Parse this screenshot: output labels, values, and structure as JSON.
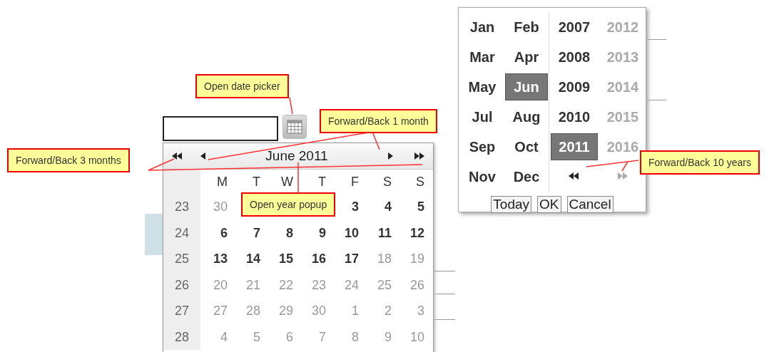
{
  "calendar": {
    "title": "June 2011",
    "weekdays": [
      "M",
      "T",
      "W",
      "T",
      "F",
      "S",
      "S"
    ],
    "weeks": [
      {
        "number": "23",
        "days": [
          {
            "label": "30",
            "enabled": false
          },
          {
            "label": "3",
            "enabled": true
          },
          {
            "label": "4",
            "enabled": true
          },
          {
            "label": "5",
            "enabled": true
          }
        ]
      },
      {
        "number": "24",
        "days": [
          {
            "label": "6",
            "enabled": true
          },
          {
            "label": "7",
            "enabled": true
          },
          {
            "label": "8",
            "enabled": true
          },
          {
            "label": "9",
            "enabled": true
          },
          {
            "label": "10",
            "enabled": true
          },
          {
            "label": "11",
            "enabled": true
          },
          {
            "label": "12",
            "enabled": true
          }
        ]
      },
      {
        "number": "25",
        "days": [
          {
            "label": "13",
            "enabled": true
          },
          {
            "label": "14",
            "enabled": true
          },
          {
            "label": "15",
            "enabled": true
          },
          {
            "label": "16",
            "enabled": true
          },
          {
            "label": "17",
            "enabled": true
          },
          {
            "label": "18",
            "enabled": false
          },
          {
            "label": "19",
            "enabled": false
          }
        ]
      },
      {
        "number": "26",
        "days": [
          {
            "label": "20",
            "enabled": false
          },
          {
            "label": "21",
            "enabled": false
          },
          {
            "label": "22",
            "enabled": false
          },
          {
            "label": "23",
            "enabled": false
          },
          {
            "label": "24",
            "enabled": false
          },
          {
            "label": "25",
            "enabled": false
          },
          {
            "label": "26",
            "enabled": false
          }
        ]
      },
      {
        "number": "27",
        "days": [
          {
            "label": "27",
            "enabled": false
          },
          {
            "label": "28",
            "enabled": false
          },
          {
            "label": "29",
            "enabled": false
          },
          {
            "label": "30",
            "enabled": false
          },
          {
            "label": "1",
            "enabled": false
          },
          {
            "label": "2",
            "enabled": false
          },
          {
            "label": "3",
            "enabled": false
          }
        ]
      },
      {
        "number": "28",
        "days": [
          {
            "label": "4",
            "enabled": false
          },
          {
            "label": "5",
            "enabled": false
          },
          {
            "label": "6",
            "enabled": false
          },
          {
            "label": "7",
            "enabled": false
          },
          {
            "label": "8",
            "enabled": false
          },
          {
            "label": "9",
            "enabled": false
          },
          {
            "label": "10",
            "enabled": false
          }
        ]
      }
    ]
  },
  "year_popup": {
    "months": [
      {
        "label": "Jan",
        "selected": false
      },
      {
        "label": "Feb",
        "selected": false
      },
      {
        "label": "Mar",
        "selected": false
      },
      {
        "label": "Apr",
        "selected": false
      },
      {
        "label": "May",
        "selected": false
      },
      {
        "label": "Jun",
        "selected": true
      },
      {
        "label": "Jul",
        "selected": false
      },
      {
        "label": "Aug",
        "selected": false
      },
      {
        "label": "Sep",
        "selected": false
      },
      {
        "label": "Oct",
        "selected": false
      },
      {
        "label": "Nov",
        "selected": false
      },
      {
        "label": "Dec",
        "selected": false
      }
    ],
    "years": [
      {
        "label": "2007",
        "selected": false,
        "disabled": false
      },
      {
        "label": "2012",
        "selected": false,
        "disabled": true
      },
      {
        "label": "2008",
        "selected": false,
        "disabled": false
      },
      {
        "label": "2013",
        "selected": false,
        "disabled": true
      },
      {
        "label": "2009",
        "selected": false,
        "disabled": false
      },
      {
        "label": "2014",
        "selected": false,
        "disabled": true
      },
      {
        "label": "2010",
        "selected": false,
        "disabled": false
      },
      {
        "label": "2015",
        "selected": false,
        "disabled": true
      },
      {
        "label": "2011",
        "selected": true,
        "disabled": false
      },
      {
        "label": "2016",
        "selected": false,
        "disabled": true
      }
    ],
    "buttons": [
      "Today",
      "OK",
      "Cancel"
    ]
  },
  "callouts": [
    {
      "text": "Open date picker"
    },
    {
      "text": "Forward/Back 1 month"
    },
    {
      "text": "Forward/Back 3 months"
    },
    {
      "text": "Open year popup"
    },
    {
      "text": "Forward/Back 10 years"
    }
  ]
}
